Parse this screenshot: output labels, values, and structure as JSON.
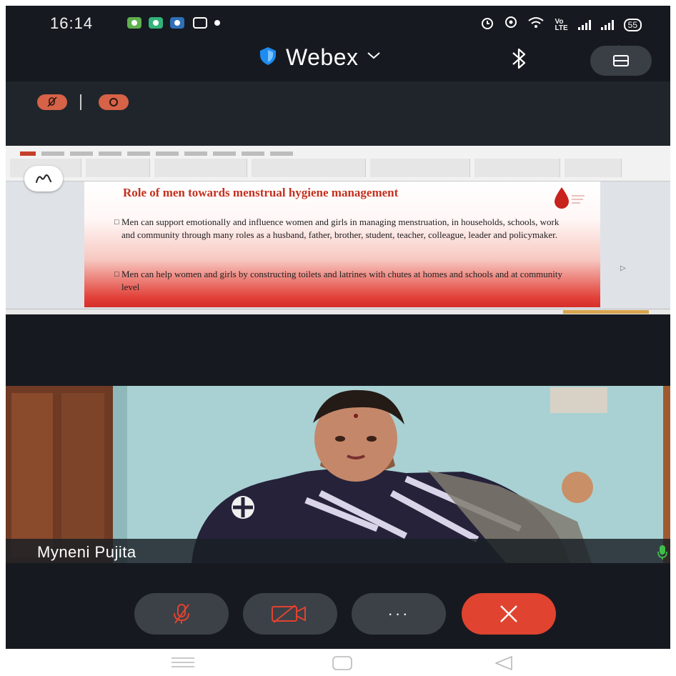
{
  "status_bar": {
    "time": "16:14",
    "network_label": "Vo\nLTE",
    "battery_level": "55"
  },
  "header": {
    "app_name": "Webex",
    "icons": [
      "shield-icon",
      "chevron-down-icon",
      "bluetooth-icon",
      "participants-icon"
    ]
  },
  "shared_screen": {
    "slide": {
      "title": "Role of men towards menstrual hygiene management",
      "bullets": [
        "Men can support emotionally and influence women and girls in managing menstruation, in households, schools, work and community through many roles as a husband, father, brother, student, teacher, colleague, leader and policymaker.",
        "Men can help women and girls by constructing toilets and latrines with chutes at homes and schools and at community level"
      ]
    }
  },
  "video": {
    "participant_name": "Myneni Pujita"
  },
  "controls": {
    "more_label": "···"
  },
  "colors": {
    "background": "#161a20",
    "leave_red": "#e0432f",
    "muted_orange": "#d66247",
    "control_gray": "#3c4047",
    "slide_title_red": "#c3311e",
    "audio_green": "#3fbf4a"
  }
}
